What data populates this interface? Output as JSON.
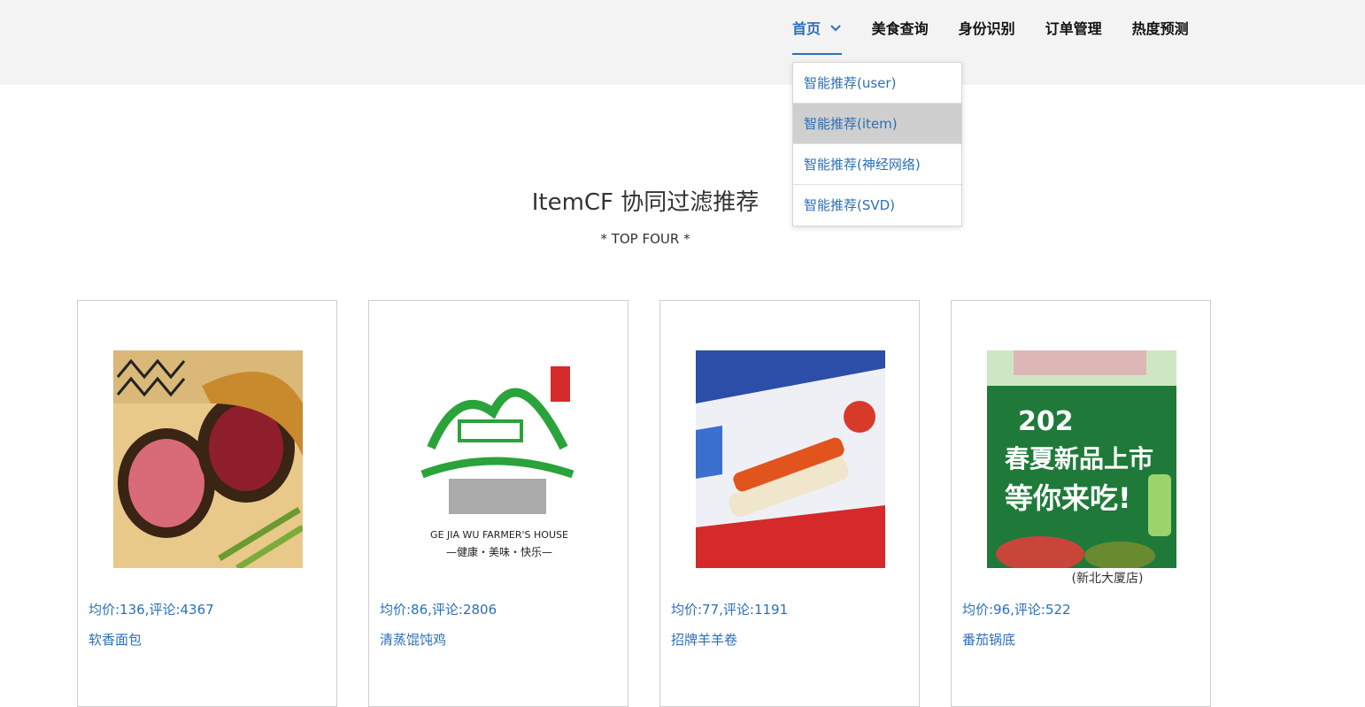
{
  "nav": {
    "items": [
      {
        "label": "首页",
        "active": true
      },
      {
        "label": "美食查询",
        "active": false
      },
      {
        "label": "身份识别",
        "active": false
      },
      {
        "label": "订单管理",
        "active": false
      },
      {
        "label": "热度预测",
        "active": false
      }
    ],
    "dropdown": [
      {
        "label": "智能推荐(user)"
      },
      {
        "label": "智能推荐(item)"
      },
      {
        "label": "智能推荐(神经网络)"
      },
      {
        "label": "智能推荐(SVD)"
      }
    ]
  },
  "main": {
    "title": "ItemCF 协同过滤推荐",
    "subtitle": "* TOP FOUR *"
  },
  "cards": [
    {
      "shop": "",
      "meta": "均价:136,评论:4367",
      "dish": "软香面包"
    },
    {
      "shop": "",
      "meta": "均价:86,评论:2806",
      "dish": "清蒸馄饨鸡"
    },
    {
      "shop": "",
      "meta": "均价:77,评论:1191",
      "dish": "招牌羊羊卷"
    },
    {
      "shop": "(新北大厦店)",
      "meta": "均价:96,评论:522",
      "dish": "番茄锅底"
    }
  ],
  "colors": {
    "accent": "#2c6fb7",
    "topbar": "#f3f3f3",
    "dropdown_hover": "#cfcfcf"
  },
  "card_images": {
    "image_1": {
      "text": ""
    },
    "image_2": {
      "text_en": "GE JIA WU FARMER'S HOUSE",
      "text_cn": "—健康・美味・快乐—"
    },
    "image_3": {
      "text": ""
    },
    "image_4": {
      "line1": "202",
      "line2": "春夏新品上市",
      "line3": "等你来吃!"
    }
  }
}
